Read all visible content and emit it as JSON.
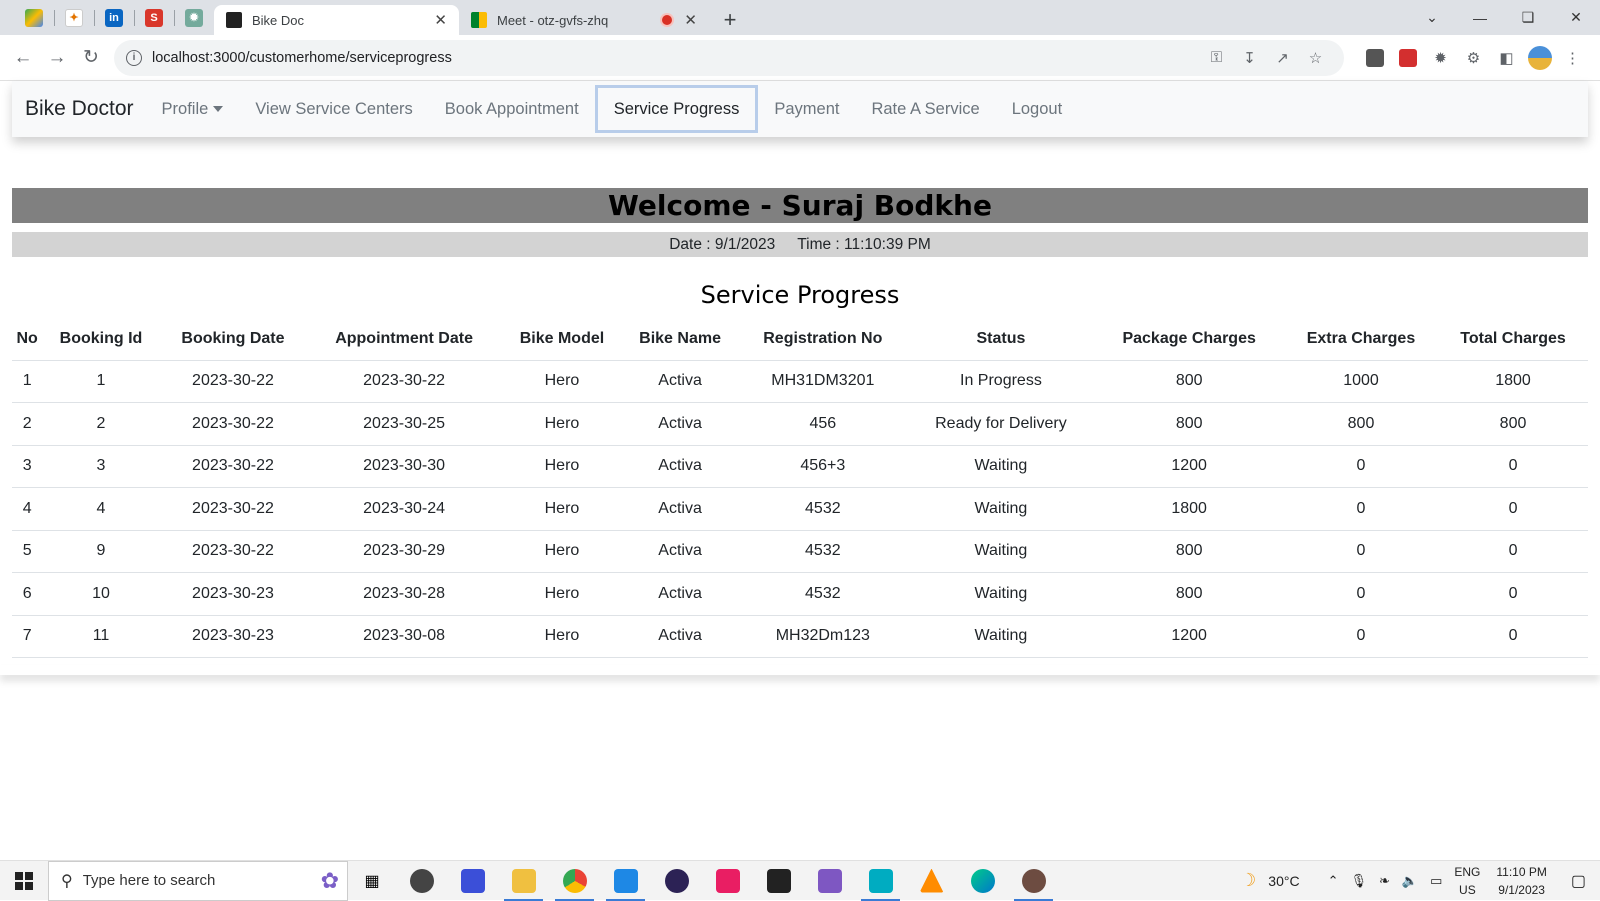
{
  "browser": {
    "pinned_tabs": [
      "google-drive",
      "gemini",
      "linkedin",
      "s-app",
      "chatgpt"
    ],
    "tabs": [
      {
        "title": "Bike Doc",
        "active": true
      },
      {
        "title": "Meet - otz-gvfs-zhq",
        "active": false
      }
    ],
    "url": "localhost:3000/customerhome/serviceprogress"
  },
  "navbar": {
    "brand": "Bike Doctor",
    "links": [
      "Profile",
      "View Service Centers",
      "Book Appointment",
      "Service Progress",
      "Payment",
      "Rate A Service",
      "Logout"
    ],
    "active": "Service Progress"
  },
  "welcome": "Welcome - Suraj Bodkhe",
  "date": "Date : 9/1/2023",
  "time": "Time : 11:10:39 PM",
  "section_title": "Service Progress",
  "table": {
    "headers": [
      "No",
      "Booking Id",
      "Booking Date",
      "Appointment Date",
      "Bike Model",
      "Bike Name",
      "Registration No",
      "Status",
      "Package Charges",
      "Extra Charges",
      "Total Charges"
    ],
    "rows": [
      [
        "1",
        "1",
        "2023-30-22",
        "2023-30-22",
        "Hero",
        "Activa",
        "MH31DM3201",
        "In Progress",
        "800",
        "1000",
        "1800"
      ],
      [
        "2",
        "2",
        "2023-30-22",
        "2023-30-25",
        "Hero",
        "Activa",
        "456",
        "Ready for Delivery",
        "800",
        "800",
        "800"
      ],
      [
        "3",
        "3",
        "2023-30-22",
        "2023-30-30",
        "Hero",
        "Activa",
        "456+3",
        "Waiting",
        "1200",
        "0",
        "0"
      ],
      [
        "4",
        "4",
        "2023-30-22",
        "2023-30-24",
        "Hero",
        "Activa",
        "4532",
        "Waiting",
        "1800",
        "0",
        "0"
      ],
      [
        "5",
        "9",
        "2023-30-22",
        "2023-30-29",
        "Hero",
        "Activa",
        "4532",
        "Waiting",
        "800",
        "0",
        "0"
      ],
      [
        "6",
        "10",
        "2023-30-23",
        "2023-30-28",
        "Hero",
        "Activa",
        "4532",
        "Waiting",
        "800",
        "0",
        "0"
      ],
      [
        "7",
        "11",
        "2023-30-23",
        "2023-30-08",
        "Hero",
        "Activa",
        "MH32Dm123",
        "Waiting",
        "1200",
        "0",
        "0"
      ]
    ]
  },
  "taskbar": {
    "search_placeholder": "Type here to search",
    "weather": "30°C",
    "lang": "ENG",
    "region": "US",
    "time": "11:10 PM",
    "date": "9/1/2023"
  }
}
